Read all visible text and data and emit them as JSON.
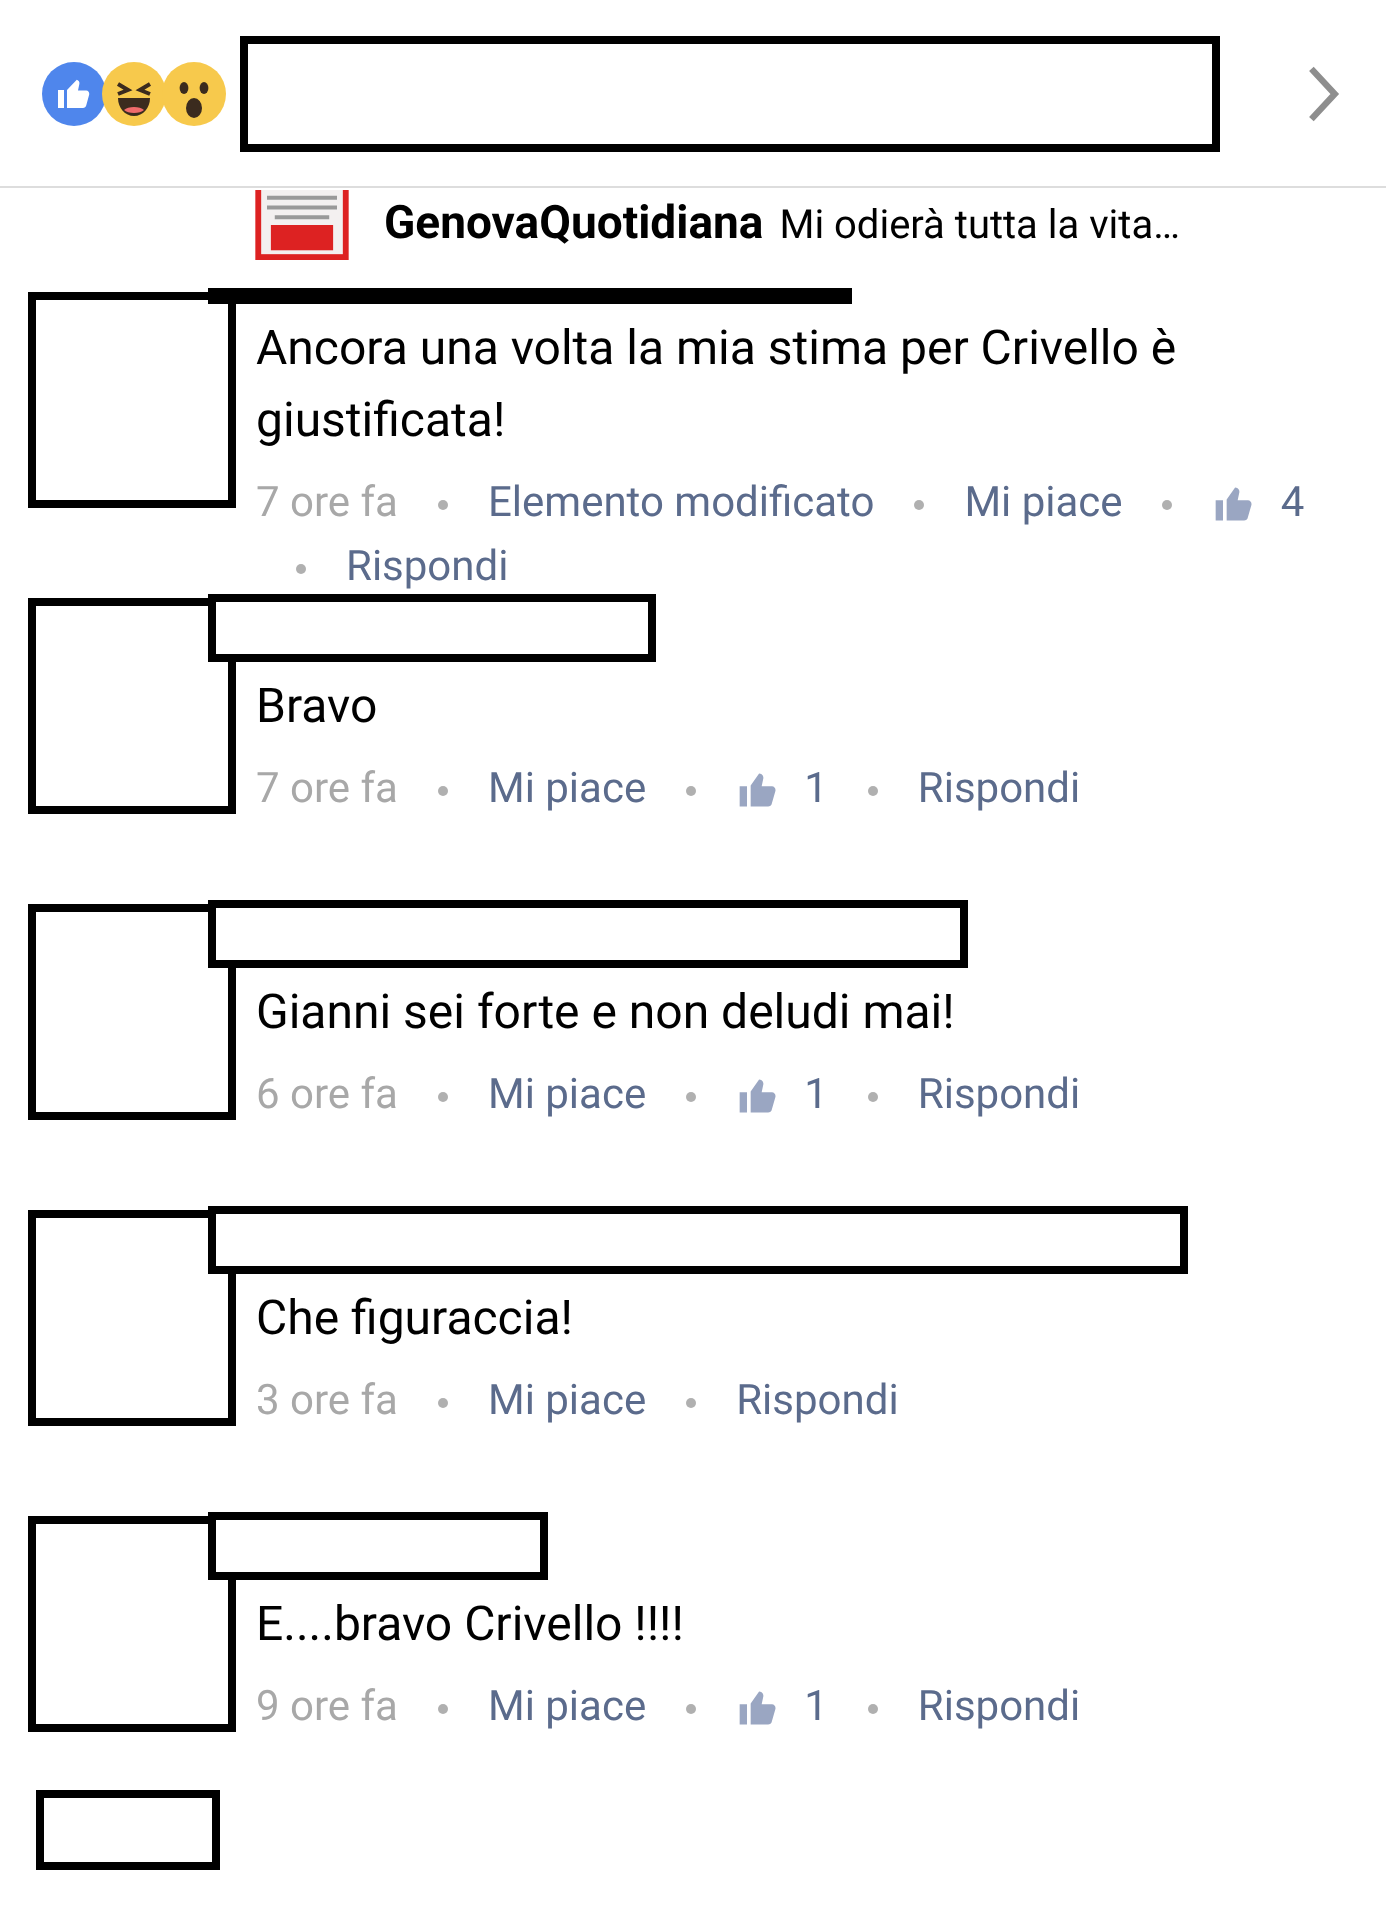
{
  "post": {
    "page_name": "GenovaQuotidiana",
    "excerpt": "Mi odierà tutta la vita…"
  },
  "comments": [
    {
      "text": "Ancora una volta la mia stima per Crivello è giustificata!",
      "meta": [
        {
          "kind": "time",
          "text": "7 ore fa"
        },
        {
          "kind": "link",
          "text": "Elemento modificato"
        },
        {
          "kind": "link",
          "text": "Mi piace"
        },
        {
          "kind": "count",
          "text": "4"
        },
        {
          "kind": "link",
          "text": "Rispondi"
        }
      ]
    },
    {
      "text": "Bravo",
      "meta": [
        {
          "kind": "time",
          "text": "7 ore fa"
        },
        {
          "kind": "link",
          "text": "Mi piace"
        },
        {
          "kind": "count",
          "text": "1"
        },
        {
          "kind": "link",
          "text": "Rispondi"
        }
      ]
    },
    {
      "text": "Gianni sei forte  e non deludi mai!",
      "meta": [
        {
          "kind": "time",
          "text": "6 ore fa"
        },
        {
          "kind": "link",
          "text": "Mi piace"
        },
        {
          "kind": "count",
          "text": "1"
        },
        {
          "kind": "link",
          "text": "Rispondi"
        }
      ]
    },
    {
      "text": "Che figuraccia!",
      "meta": [
        {
          "kind": "time",
          "text": "3 ore fa"
        },
        {
          "kind": "link",
          "text": "Mi piace"
        },
        {
          "kind": "link",
          "text": "Rispondi"
        }
      ]
    },
    {
      "text": "E....bravo Crivello !!!!",
      "meta": [
        {
          "kind": "time",
          "text": "9 ore fa"
        },
        {
          "kind": "link",
          "text": "Mi piace"
        },
        {
          "kind": "count",
          "text": "1"
        },
        {
          "kind": "link",
          "text": "Rispondi"
        }
      ]
    }
  ]
}
